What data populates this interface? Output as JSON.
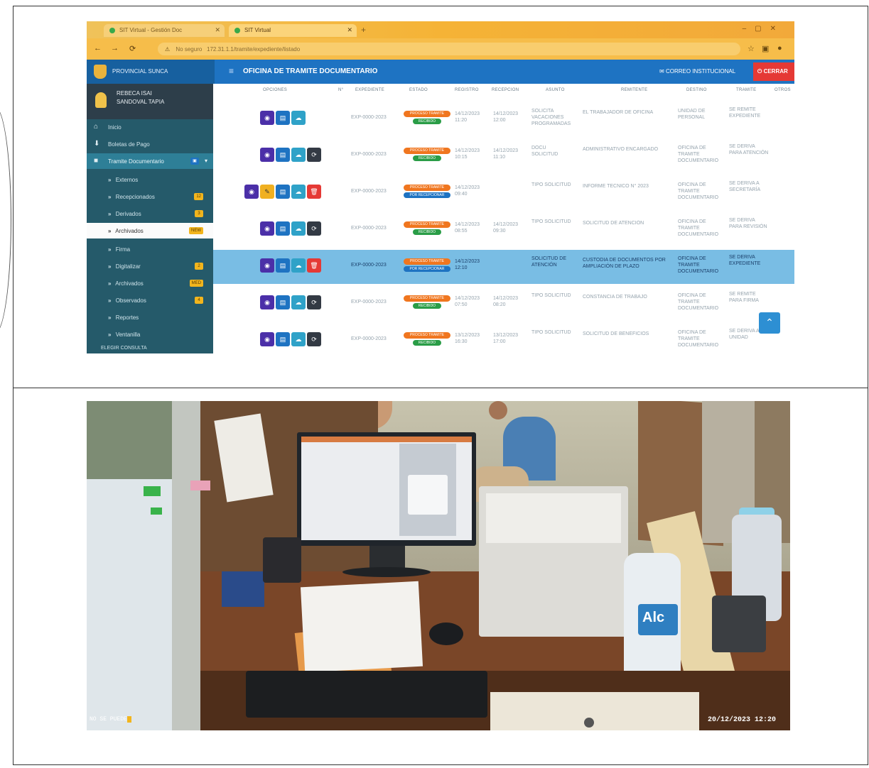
{
  "browser": {
    "tab1_title": "SIT Virtual - Gestión Doc",
    "tab2_title": "SIT Virtual",
    "url_warning": "No seguro",
    "url": "172.31.1.1/tramite/expediente/listado"
  },
  "app": {
    "brand": "PROVINCIAL SUNCA",
    "header_title": "OFICINA DE TRAMITE DOCUMENTARIO",
    "header_button_1": "CORREO INSTITUCIONAL",
    "header_button_2": "CERRAR"
  },
  "sidebar": {
    "user_name": "REBECA ISAI\nSANDOVAL TAPIA",
    "items": [
      {
        "label": "Inicio"
      },
      {
        "label": "Boletas de Pago"
      },
      {
        "label": "Tramite Documentario",
        "badge": ""
      },
      {
        "label": "Externos",
        "badge": ""
      },
      {
        "label": "Recepcionados",
        "badge": "12"
      },
      {
        "label": "Derivados",
        "badge": "3"
      },
      {
        "label": "Archivados",
        "badge": "NEW"
      },
      {
        "label": "Firma"
      },
      {
        "label": "Digitalizar",
        "badge": "2"
      },
      {
        "label": "Archivados",
        "badge": "MED"
      },
      {
        "label": "Observados",
        "badge": "4"
      },
      {
        "label": "Reportes"
      },
      {
        "label": "Ventanilla"
      }
    ],
    "footer": "ELEGIR CONSULTA"
  },
  "table": {
    "headers": [
      "OPCIONES",
      "N°",
      "EXPEDIENTE",
      "ESTADO",
      "REGISTRO",
      "RECEPCION",
      "ASUNTO",
      "REMITENTE",
      "DESTINO",
      "TRAMITE",
      "OTROS"
    ],
    "rows": [
      {
        "ops": [
          "eye",
          "doc",
          "cloud"
        ],
        "exp": "EXP-0000-2023",
        "estado": "PROCESO TRAMITE",
        "sub": "RECIBIDO",
        "sub_color": "green",
        "reg": "14/12/2023 11:20",
        "rec": "14/12/2023 12:00",
        "asunto": "SOLICITA VACACIONES PROGRAMADAS",
        "remitente": "EL TRABAJADOR DE OFICINA",
        "destino": "UNIDAD DE PERSONAL",
        "tramite": "SE REMITE EXPEDIENTE"
      },
      {
        "ops": [
          "eye",
          "doc",
          "cloud",
          "sync"
        ],
        "exp": "EXP-0000-2023",
        "estado": "PROCESO TRAMITE",
        "sub": "RECIBIDO",
        "sub_color": "green",
        "reg": "14/12/2023 10:15",
        "rec": "14/12/2023 11:10",
        "asunto": "DOCU SOLICITUD",
        "remitente": "ADMINISTRATIVO ENCARGADO",
        "destino": "OFICINA DE TRAMITE DOCUMENTARIO",
        "tramite": "SE DERIVA PARA ATENCIÓN"
      },
      {
        "ops": [
          "eye",
          "edit",
          "doc",
          "cloud",
          "trash"
        ],
        "exp": "EXP-0000-2023",
        "estado": "PROCESO TRAMITE",
        "sub": "POR RECEPCIONAR",
        "sub_color": "blue",
        "reg": "14/12/2023 09:40",
        "rec": "",
        "asunto": "TIPO SOLICITUD",
        "remitente": "INFORME TECNICO N° 2023",
        "destino": "OFICINA DE TRAMITE DOCUMENTARIO",
        "tramite": "SE DERIVA A SECRETARÍA"
      },
      {
        "ops": [
          "eye",
          "doc",
          "cloud",
          "sync"
        ],
        "exp": "EXP-0000-2023",
        "estado": "PROCESO TRAMITE",
        "sub": "RECIBIDO",
        "sub_color": "green",
        "reg": "14/12/2023 08:55",
        "rec": "14/12/2023 09:30",
        "asunto": "TIPO SOLICITUD",
        "remitente": "SOLICITUD DE ATENCIÓN",
        "destino": "OFICINA DE TRAMITE DOCUMENTARIO",
        "tramite": "SE DERIVA PARA REVISIÓN"
      },
      {
        "ops": [
          "eye",
          "doc",
          "cloud",
          "trash"
        ],
        "exp": "EXP-0000-2023",
        "estado": "PROCESO TRAMITE",
        "sub": "POR RECEPCIONAR",
        "sub_color": "blue",
        "reg": "14/12/2023 12:10",
        "rec": "",
        "asunto": "SOLICITUD DE ATENCIÓN",
        "remitente": "CUSTODIA DE DOCUMENTOS POR AMPLIACIÓN DE PLAZO",
        "destino": "OFICINA DE TRAMITE DOCUMENTARIO",
        "tramite": "SE DERIVA EXPEDIENTE"
      },
      {
        "ops": [
          "eye",
          "doc",
          "cloud",
          "sync"
        ],
        "exp": "EXP-0000-2023",
        "estado": "PROCESO TRAMITE",
        "sub": "RECIBIDO",
        "sub_color": "green",
        "reg": "14/12/2023 07:50",
        "rec": "14/12/2023 08:20",
        "asunto": "TIPO SOLICITUD",
        "remitente": "CONSTANCIA DE TRABAJO",
        "destino": "OFICINA DE TRAMITE DOCUMENTARIO",
        "tramite": "SE REMITE PARA FIRMA"
      },
      {
        "ops": [
          "eye",
          "doc",
          "cloud",
          "sync"
        ],
        "exp": "EXP-0000-2023",
        "estado": "PROCESO TRAMITE",
        "sub": "RECIBIDO",
        "sub_color": "green",
        "reg": "13/12/2023 16:30",
        "rec": "13/12/2023 17:00",
        "asunto": "TIPO SOLICITUD",
        "remitente": "SOLICITUD DE BENEFICIOS",
        "destino": "OFICINA DE TRAMITE DOCUMENTARIO",
        "tramite": "SE DERIVA A LA UNIDAD"
      }
    ]
  },
  "photo": {
    "timestamp_left": "NO SE PUEDE",
    "timestamp_left_highlight": "",
    "timestamp_right": "20/12/2023 12:20",
    "bottle_label": "Alc"
  }
}
